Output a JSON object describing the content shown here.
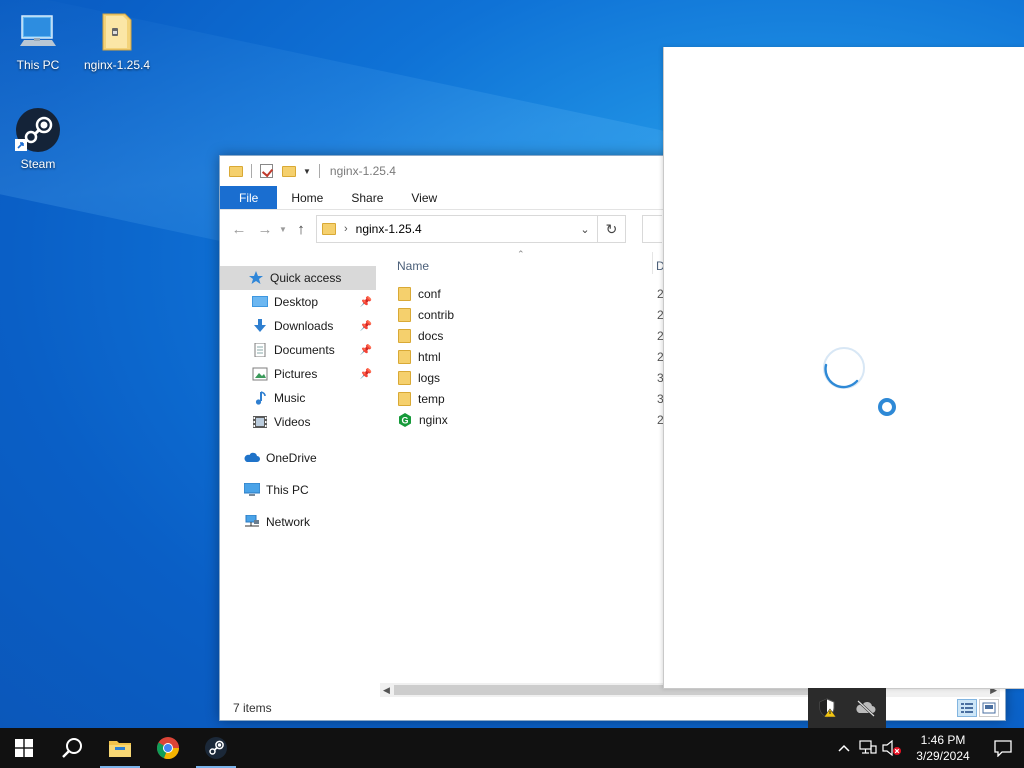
{
  "desktop": {
    "icons": [
      {
        "label": "This PC",
        "icon": "this-pc-icon"
      },
      {
        "label": "nginx-1.25.4",
        "icon": "zip-folder-icon"
      },
      {
        "label": "Steam",
        "icon": "steam-icon"
      }
    ]
  },
  "explorer": {
    "title": "nginx-1.25.4",
    "ribbon_tabs": [
      "File",
      "Home",
      "Share",
      "View"
    ],
    "address": {
      "path": "nginx-1.25.4"
    },
    "nav_pane": [
      {
        "label": "Quick access",
        "icon": "star-icon",
        "selected": true
      },
      {
        "label": "Desktop",
        "icon": "desktop-icon",
        "pinned": true
      },
      {
        "label": "Downloads",
        "icon": "download-icon",
        "pinned": true
      },
      {
        "label": "Documents",
        "icon": "documents-icon",
        "pinned": true
      },
      {
        "label": "Pictures",
        "icon": "pictures-icon",
        "pinned": true
      },
      {
        "label": "Music",
        "icon": "music-icon"
      },
      {
        "label": "Videos",
        "icon": "videos-icon"
      },
      {
        "label": "OneDrive",
        "icon": "onedrive-icon"
      },
      {
        "label": "This PC",
        "icon": "this-pc-icon"
      },
      {
        "label": "Network",
        "icon": "network-icon"
      }
    ],
    "columns": {
      "name": "Name",
      "date": "D"
    },
    "files": [
      {
        "name": "conf",
        "type": "folder",
        "date": "2"
      },
      {
        "name": "contrib",
        "type": "folder",
        "date": "2"
      },
      {
        "name": "docs",
        "type": "folder",
        "date": "2"
      },
      {
        "name": "html",
        "type": "folder",
        "date": "2"
      },
      {
        "name": "logs",
        "type": "folder",
        "date": "3"
      },
      {
        "name": "temp",
        "type": "folder",
        "date": "3"
      },
      {
        "name": "nginx",
        "type": "exe",
        "date": "2"
      }
    ],
    "status": "7 items"
  },
  "taskbar": {
    "time": "1:46 PM",
    "date": "3/29/2024"
  },
  "colors": {
    "accent": "#1a6ed0",
    "folder": "#f5d06d",
    "taskbar": "#111111",
    "spinner": "#2e89d6"
  }
}
